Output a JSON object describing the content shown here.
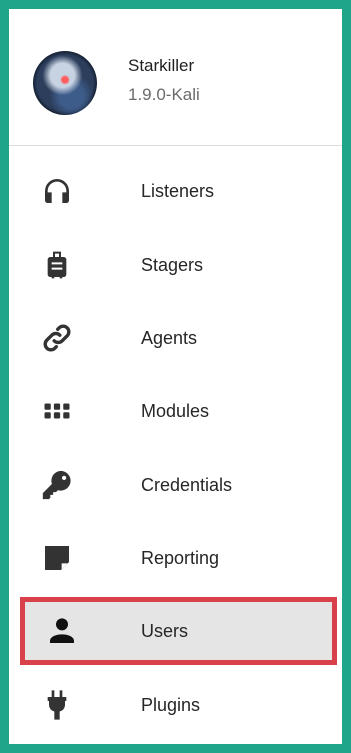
{
  "app": {
    "name": "Starkiller",
    "version": "1.9.0-Kali",
    "avatar_icon": "starkiller-logo"
  },
  "colors": {
    "frame": "#1fa58a",
    "selection_outline": "#d8404a",
    "selected_background": "#e5e5e5",
    "icon": "#333333"
  },
  "nav": {
    "items": [
      {
        "label": "Listeners",
        "icon": "headphones-icon"
      },
      {
        "label": "Stagers",
        "icon": "luggage-icon"
      },
      {
        "label": "Agents",
        "icon": "link-icon"
      },
      {
        "label": "Modules",
        "icon": "grid-icon"
      },
      {
        "label": "Credentials",
        "icon": "key-icon"
      },
      {
        "label": "Reporting",
        "icon": "note-icon"
      },
      {
        "label": "Users",
        "icon": "user-icon",
        "selected": true
      },
      {
        "label": "Plugins",
        "icon": "plug-icon"
      }
    ]
  }
}
